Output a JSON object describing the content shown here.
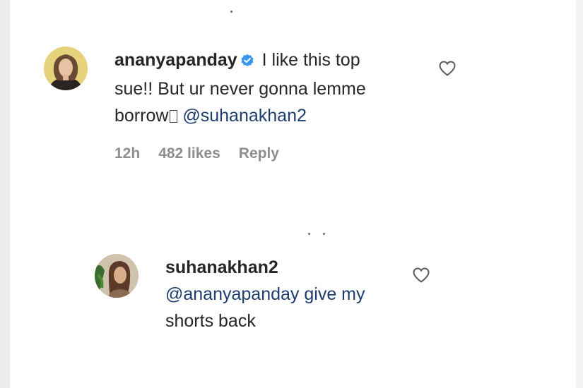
{
  "comments": [
    {
      "username": "ananyapanday",
      "verified": true,
      "text_line1": "I like this top",
      "text_line2": "sue!! But ur never gonna lemme",
      "text_line3_pre": "borrow",
      "text_line3_mention": "@suhanakhan2",
      "time": "12h",
      "likes": "482 likes",
      "reply_label": "Reply"
    },
    {
      "username": "suhanakhan2",
      "verified": false,
      "text_line1": "@ananyapanday give my",
      "text_line2": "shorts back"
    }
  ],
  "icons": {
    "like": "heart-outline-icon",
    "verified": "verified-badge-icon"
  },
  "colors": {
    "text": "#262626",
    "meta": "#8e8e8e",
    "verified": "#3897f0"
  }
}
